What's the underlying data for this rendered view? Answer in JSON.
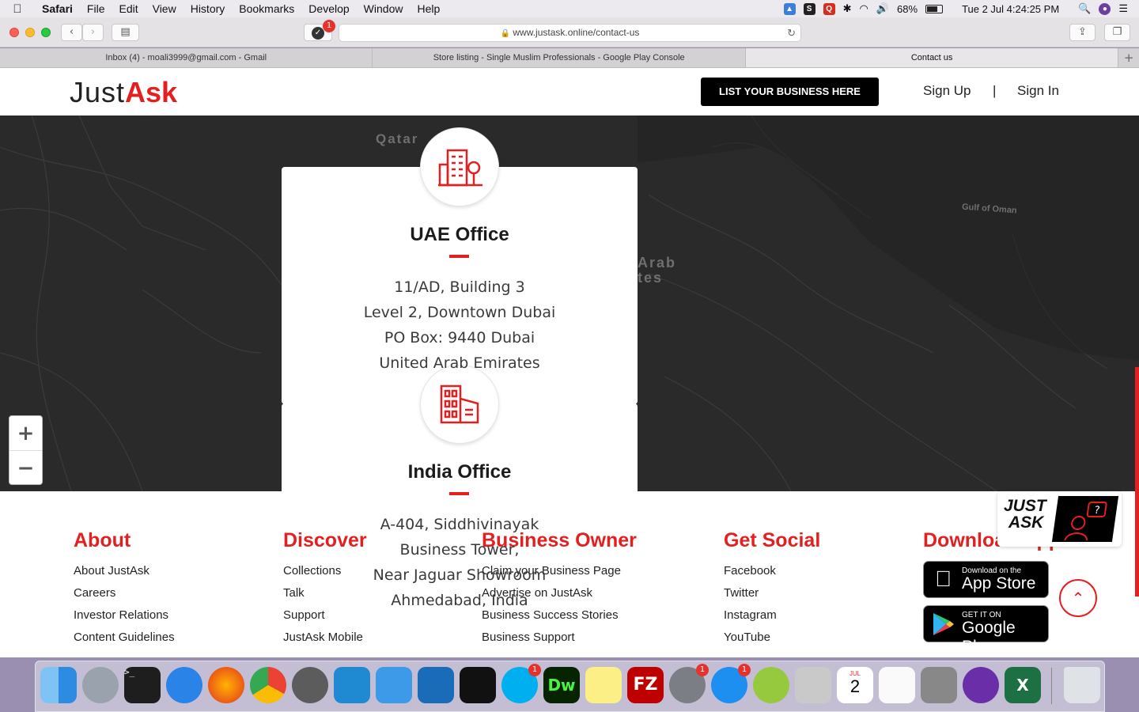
{
  "menubar": {
    "items": [
      "Safari",
      "File",
      "Edit",
      "View",
      "History",
      "Bookmarks",
      "Develop",
      "Window",
      "Help"
    ],
    "battery": "68%",
    "datetime": "Tue 2 Jul  4:24:25 PM"
  },
  "browser": {
    "url": "www.justask.online/contact-us",
    "badge_count": "1",
    "tabs": [
      {
        "label": "Inbox (4) - moali3999@gmail.com - Gmail"
      },
      {
        "label": "Store listing - Single Muslim Professionals - Google Play Console"
      },
      {
        "label": "Contact us"
      }
    ]
  },
  "header": {
    "logo_just": "Just",
    "logo_ask": "Ask",
    "cta": "LIST YOUR BUSINESS HERE",
    "signup": "Sign Up",
    "divider": "|",
    "signin": "Sign In"
  },
  "map": {
    "labels": {
      "qatar": "Qatar",
      "gulf": "Gulf of Oman",
      "arab": "Arab",
      "tes": "tes"
    }
  },
  "offices": {
    "uae": {
      "title": "UAE Office",
      "lines": [
        "11/AD, Building 3",
        "Level 2, Downtown Dubai",
        "PO Box: 9440 Dubai",
        "United Arab Emirates"
      ]
    },
    "india": {
      "title": "India Office",
      "lines": [
        "A-404, Siddhivinayak",
        "Business Tower,",
        "Near Jaguar Showroom",
        "Ahmedabad, India"
      ]
    }
  },
  "footer": {
    "about": {
      "title": "About",
      "links": [
        "About JustAsk",
        "Careers",
        "Investor Relations",
        "Content Guidelines"
      ]
    },
    "discover": {
      "title": "Discover",
      "links": [
        "Collections",
        "Talk",
        "Support",
        "JustAsk Mobile"
      ]
    },
    "business": {
      "title": "Business Owner",
      "links": [
        "Claim your Business Page",
        "Advertise on JustAsk",
        "Business Success Stories",
        "Business Support"
      ]
    },
    "social": {
      "title": "Get Social",
      "links": [
        "Facebook",
        "Twitter",
        "Instagram",
        "YouTube"
      ]
    },
    "download": {
      "title": "Download App",
      "appstore_small": "Download on the",
      "appstore_big": "App Store",
      "googleplay_small": "GET IT ON",
      "googleplay_big": "Google Play"
    },
    "widget": {
      "line1": "JUST",
      "line2": "ASK"
    }
  },
  "dock": {
    "calendar_month": "JUL",
    "calendar_day": "2",
    "badges": {
      "skype": "1",
      "settings": "1",
      "appstore": "1"
    }
  },
  "colors": {
    "brand_red": "#e41f1f",
    "map_bg": "#2a2a2a"
  }
}
